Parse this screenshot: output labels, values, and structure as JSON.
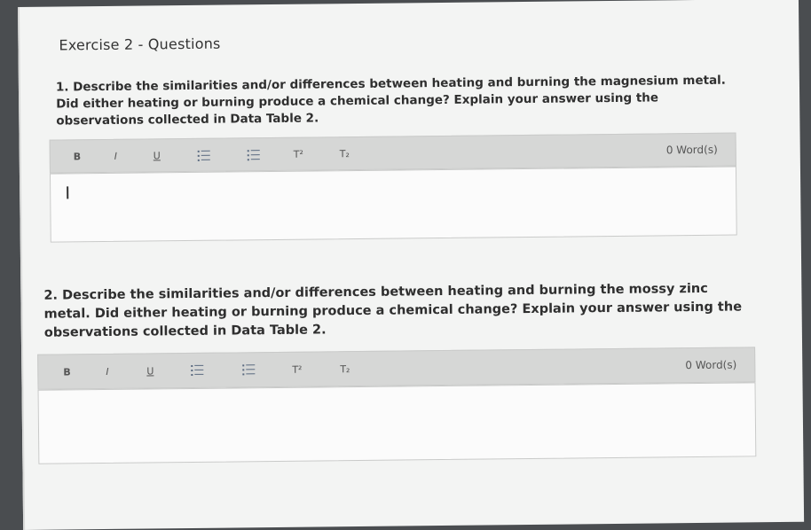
{
  "page": {
    "title": "Exercise 2 - Questions"
  },
  "questions": [
    {
      "text": "1. Describe the similarities and/or differences between heating and burning the magnesium metal. Did either heating or burning produce a chemical change? Explain your answer using the observations collected in Data Table 2.",
      "toolbar": {
        "bold": "B",
        "italic": "I",
        "underline": "U",
        "bullet_list_icon": "bullet-list-icon",
        "numbered_list_icon": "numbered-list-icon",
        "superscript": "T²",
        "subscript": "T₂",
        "word_count": "0 Word(s)"
      },
      "answer": ""
    },
    {
      "text": "2. Describe the similarities and/or differences between heating and burning the mossy zinc metal. Did either heating or burning produce a chemical change? Explain your answer using the observations collected in Data Table 2.",
      "toolbar": {
        "bold": "B",
        "italic": "I",
        "underline": "U",
        "bullet_list_icon": "bullet-list-icon",
        "numbered_list_icon": "numbered-list-icon",
        "superscript": "T²",
        "subscript": "T₂",
        "word_count": "0 Word(s)"
      },
      "answer": ""
    }
  ],
  "colors": {
    "background": "#4a4d50",
    "page": "#f3f4f3",
    "toolbar": "#d6d7d6",
    "editor": "#fbfbfb",
    "text": "#2f2f2f"
  }
}
